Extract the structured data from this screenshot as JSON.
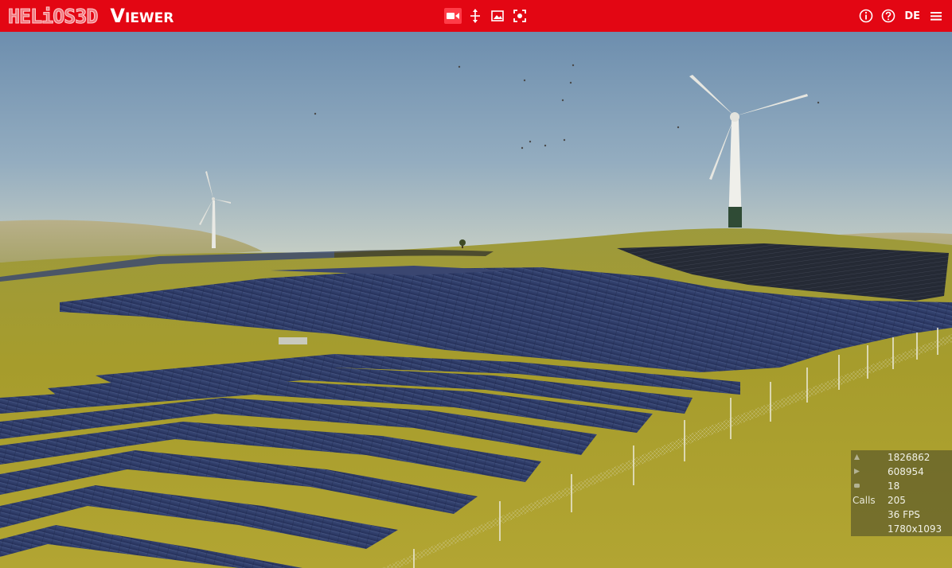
{
  "app": {
    "logo_text": "HELiOS3D",
    "product": "Viewer"
  },
  "toolbar": {
    "tools": [
      {
        "name": "camera-tool",
        "icon": "video-camera-icon"
      },
      {
        "name": "move-tool",
        "icon": "arrows-move-icon"
      },
      {
        "name": "image-tool",
        "icon": "picture-icon"
      },
      {
        "name": "focus-tool",
        "icon": "focus-target-icon"
      }
    ],
    "info_icon": "info-circle-icon",
    "help_icon": "question-circle-icon",
    "language": "DE",
    "menu_icon": "hamburger-menu-icon"
  },
  "stats": {
    "triangles": "1826862",
    "points": "608954",
    "textures": "18",
    "calls_label": "Calls",
    "calls": "205",
    "fps": "36 FPS",
    "resolution": "1780x1093"
  },
  "colors": {
    "brand_red": "#e30613",
    "sky_top": "#6f8fad",
    "sky_horizon": "#c7cfc4",
    "ground": "#a79d2c",
    "panel": "#2c3a66"
  }
}
